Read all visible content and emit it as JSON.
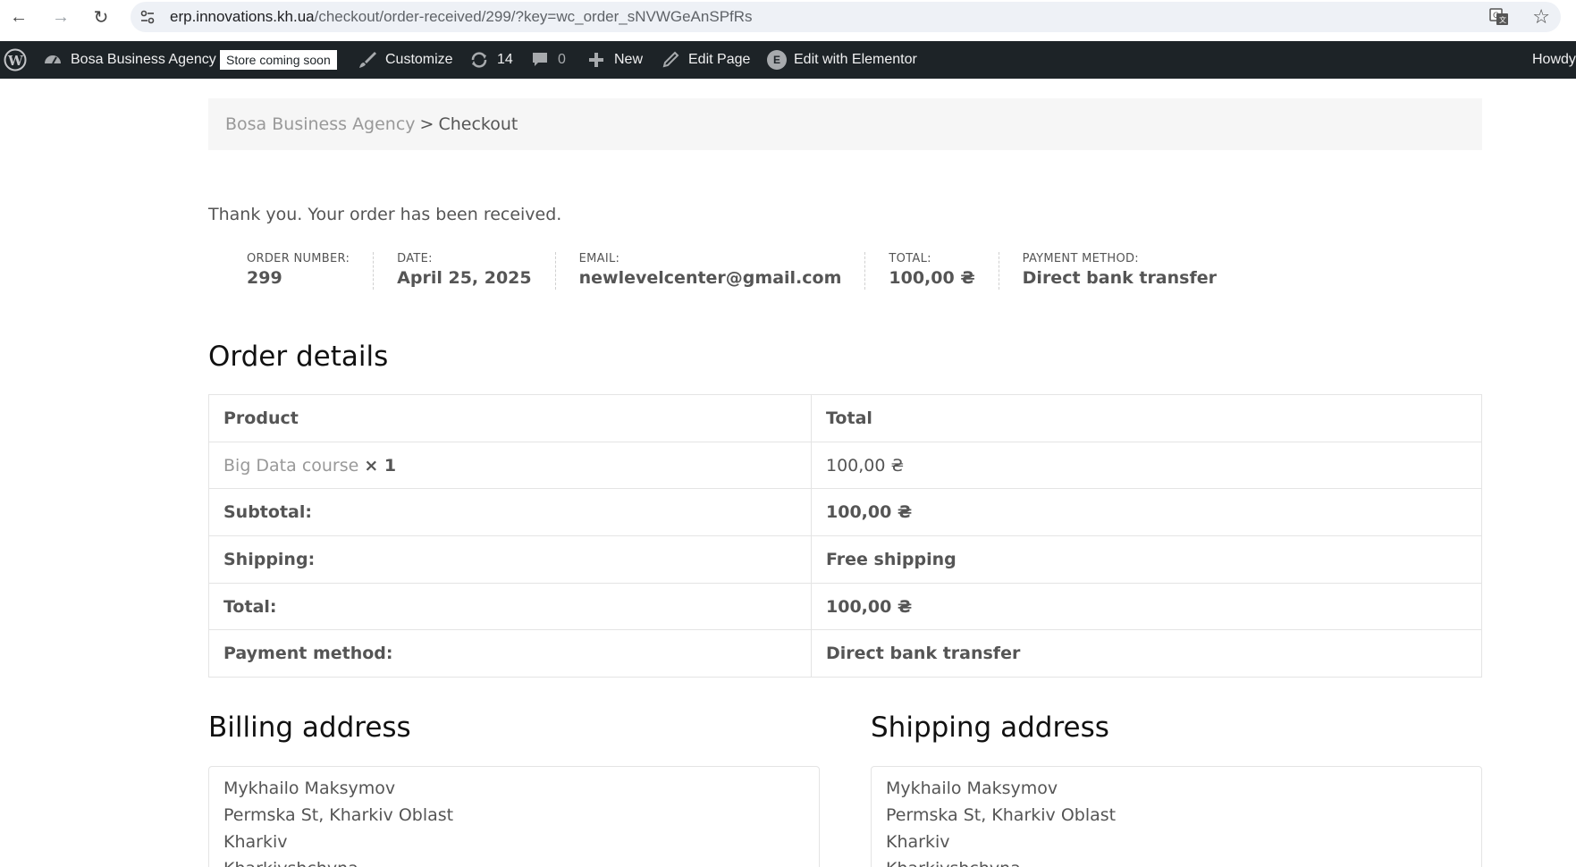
{
  "browser": {
    "url_host": "erp.innovations.kh.ua",
    "url_path": "/checkout/order-received/299/?key=wc_order_sNVWGeAnSPfRs"
  },
  "admin_bar": {
    "site_name": "Bosa Business Agency",
    "store_badge": "Store coming soon",
    "customize": "Customize",
    "updates_count": "14",
    "comments_count": "0",
    "new": "New",
    "edit_page": "Edit Page",
    "edit_elementor": "Edit with Elementor",
    "howdy": "Howdy"
  },
  "breadcrumb": {
    "home": "Bosa Business Agency",
    "separator": ">",
    "current": "Checkout"
  },
  "thankyou": "Thank you. Your order has been received.",
  "overview": [
    {
      "label": "ORDER NUMBER:",
      "value": "299"
    },
    {
      "label": "DATE:",
      "value": "April 25, 2025"
    },
    {
      "label": "EMAIL:",
      "value": "newlevelcenter@gmail.com"
    },
    {
      "label": "TOTAL:",
      "value": "100,00 ₴"
    },
    {
      "label": "PAYMENT METHOD:",
      "value": "Direct bank transfer"
    }
  ],
  "order_details": {
    "title": "Order details",
    "col_product": "Product",
    "col_total": "Total",
    "item_name": "Big Data course",
    "item_qty": "× 1",
    "item_total": "100,00 ₴",
    "rows": [
      {
        "label": "Subtotal:",
        "value": "100,00 ₴"
      },
      {
        "label": "Shipping:",
        "value": "Free shipping"
      },
      {
        "label": "Total:",
        "value": "100,00 ₴"
      },
      {
        "label": "Payment method:",
        "value": "Direct bank transfer"
      }
    ]
  },
  "billing": {
    "title": "Billing address",
    "lines": [
      "Mykhailo Maksymov",
      "Permska St, Kharkiv Oblast",
      "Kharkiv",
      "Kharkivshchyna"
    ]
  },
  "shipping": {
    "title": "Shipping address",
    "lines": [
      "Mykhailo Maksymov",
      "Permska St, Kharkiv Oblast",
      "Kharkiv",
      "Kharkivshchyna"
    ]
  }
}
